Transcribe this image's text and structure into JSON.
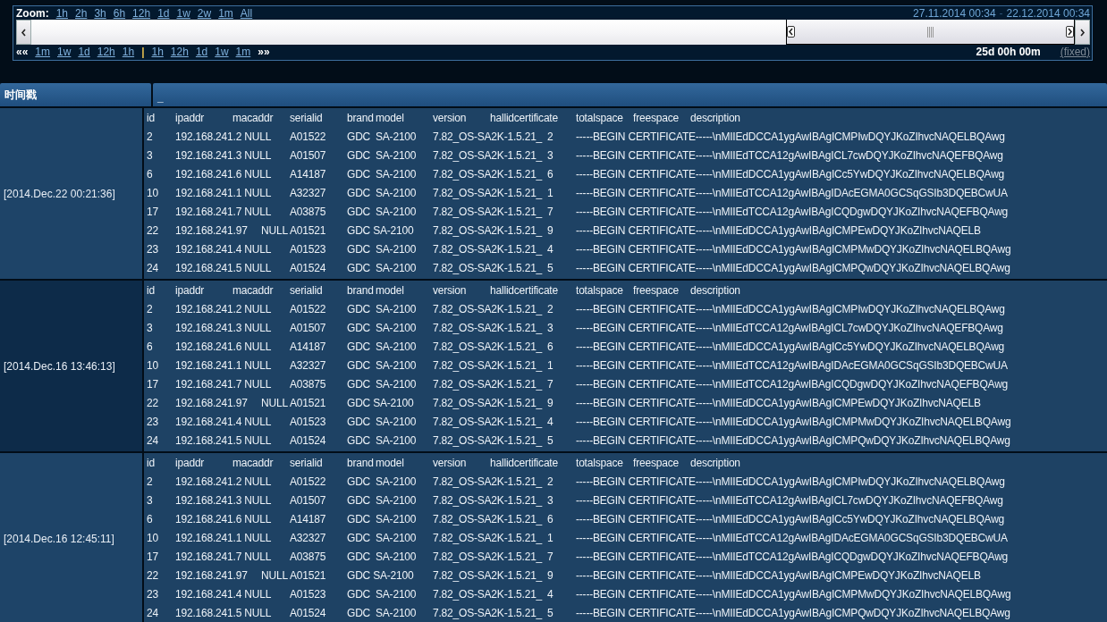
{
  "zoom_bar": {
    "label": "Zoom:",
    "presets": [
      "1h",
      "2h",
      "3h",
      "6h",
      "12h",
      "1d",
      "1w",
      "2w",
      "1m",
      "All"
    ],
    "range_start": "27.11.2014 00:34",
    "range_separator": "-",
    "range_end": "22.12.2014 00:34"
  },
  "pan_bar": {
    "back_arrows": "««",
    "back_steps": [
      "1m",
      "1w",
      "1d",
      "12h",
      "1h"
    ],
    "separator": "|",
    "forward_steps": [
      "1h",
      "12h",
      "1d",
      "1w",
      "1m"
    ],
    "forward_arrows": "»»",
    "duration": "25d 00h 00m",
    "mode": "(fixed)"
  },
  "table": {
    "columns": [
      "时间戳",
      "_"
    ],
    "groups": [
      {
        "timestamp": "[2014.Dec.22 00:21:36]",
        "highlighted": false,
        "lines": [
          "id\tipaddr\tmacaddr\tserialid\tbrand\tmodel\tversion\thallidcertificate\ttotalspace\tfreespace\tdescription",
          "2\t192.168.241.2 NULL\tA01522\tGDC\tSA-2100\t7.82_OS-SA2K-1.5.21_\t2\t-----BEGIN CERTIFICATE-----\\nMIIEdDCCA1ygAwIBAgICMPIwDQYJKoZIhvcNAQELBQAwg",
          "3\t192.168.241.3 NULL\tA01507\tGDC\tSA-2100\t7.82_OS-SA2K-1.5.21_\t3\t-----BEGIN CERTIFICATE-----\\nMIIEdTCCA12gAwIBAgICL7cwDQYJKoZIhvcNAQEFBQAwg",
          "6\t192.168.241.6 NULL\tA14187\tGDC\tSA-2100\t7.82_OS-SA2K-1.5.21_\t6\t-----BEGIN CERTIFICATE-----\\nMIIEdDCCA1ygAwIBAgICc5YwDQYJKoZIhvcNAQELBQAwg",
          "10\t192.168.241.1 NULL\tA32327\tGDC\tSA-2100\t7.82_OS-SA2K-1.5.21_\t1\t-----BEGIN CERTIFICATE-----\\nMIIEdTCCA12gAwIBAgIDAcEGMA0GCSqGSIb3DQEBCwUA",
          "17\t192.168.241.7 NULL\tA03875\tGDC\tSA-2100\t7.82_OS-SA2K-1.5.21_\t7\t-----BEGIN CERTIFICATE-----\\nMIIEdTCCA12gAwIBAgICQDgwDQYJKoZIhvcNAQEFBQAwg",
          "22\t192.168.241.97\tNULL\tA01521\tGDC SA-2100\t7.82_OS-SA2K-1.5.21_\t9\t-----BEGIN CERTIFICATE-----\\nMIIEdDCCA1ygAwIBAgICMPEwDQYJKoZIhvcNAQELB",
          "23\t192.168.241.4 NULL\tA01523\tGDC\tSA-2100\t7.82_OS-SA2K-1.5.21_\t4\t-----BEGIN CERTIFICATE-----\\nMIIEdDCCA1ygAwIBAgICMPMwDQYJKoZIhvcNAQELBQAwg",
          "24\t192.168.241.5 NULL\tA01524\tGDC\tSA-2100\t7.82_OS-SA2K-1.5.21_\t5\t-----BEGIN CERTIFICATE-----\\nMIIEdDCCA1ygAwIBAgICMPQwDQYJKoZIhvcNAQELBQAwg"
        ]
      },
      {
        "timestamp": "[2014.Dec.16 13:46:13]",
        "highlighted": true,
        "lines": [
          "id\tipaddr\tmacaddr\tserialid\tbrand\tmodel\tversion\thallidcertificate\ttotalspace\tfreespace\tdescription",
          "2\t192.168.241.2 NULL\tA01522\tGDC\tSA-2100\t7.82_OS-SA2K-1.5.21_\t2\t-----BEGIN CERTIFICATE-----\\nMIIEdDCCA1ygAwIBAgICMPIwDQYJKoZIhvcNAQELBQAwg",
          "3\t192.168.241.3 NULL\tA01507\tGDC\tSA-2100\t7.82_OS-SA2K-1.5.21_\t3\t-----BEGIN CERTIFICATE-----\\nMIIEdTCCA12gAwIBAgICL7cwDQYJKoZIhvcNAQEFBQAwg",
          "6\t192.168.241.6 NULL\tA14187\tGDC\tSA-2100\t7.82_OS-SA2K-1.5.21_\t6\t-----BEGIN CERTIFICATE-----\\nMIIEdDCCA1ygAwIBAgICc5YwDQYJKoZIhvcNAQELBQAwg",
          "10\t192.168.241.1 NULL\tA32327\tGDC\tSA-2100\t7.82_OS-SA2K-1.5.21_\t1\t-----BEGIN CERTIFICATE-----\\nMIIEdTCCA12gAwIBAgIDAcEGMA0GCSqGSIb3DQEBCwUA",
          "17\t192.168.241.7 NULL\tA03875\tGDC\tSA-2100\t7.82_OS-SA2K-1.5.21_\t7\t-----BEGIN CERTIFICATE-----\\nMIIEdTCCA12gAwIBAgICQDgwDQYJKoZIhvcNAQEFBQAwg",
          "22\t192.168.241.97\tNULL\tA01521\tGDC SA-2100\t7.82_OS-SA2K-1.5.21_\t9\t-----BEGIN CERTIFICATE-----\\nMIIEdDCCA1ygAwIBAgICMPEwDQYJKoZIhvcNAQELB",
          "23\t192.168.241.4 NULL\tA01523\tGDC\tSA-2100\t7.82_OS-SA2K-1.5.21_\t4\t-----BEGIN CERTIFICATE-----\\nMIIEdDCCA1ygAwIBAgICMPMwDQYJKoZIhvcNAQELBQAwg",
          "24\t192.168.241.5 NULL\tA01524\tGDC\tSA-2100\t7.82_OS-SA2K-1.5.21_\t5\t-----BEGIN CERTIFICATE-----\\nMIIEdDCCA1ygAwIBAgICMPQwDQYJKoZIhvcNAQELBQAwg"
        ]
      },
      {
        "timestamp": "[2014.Dec.16 12:45:11]",
        "highlighted": false,
        "lines": [
          "id\tipaddr\tmacaddr\tserialid\tbrand\tmodel\tversion\thallidcertificate\ttotalspace\tfreespace\tdescription",
          "2\t192.168.241.2 NULL\tA01522\tGDC\tSA-2100\t7.82_OS-SA2K-1.5.21_\t2\t-----BEGIN CERTIFICATE-----\\nMIIEdDCCA1ygAwIBAgICMPIwDQYJKoZIhvcNAQELBQAwg",
          "3\t192.168.241.3 NULL\tA01507\tGDC\tSA-2100\t7.82_OS-SA2K-1.5.21_\t3\t-----BEGIN CERTIFICATE-----\\nMIIEdTCCA12gAwIBAgICL7cwDQYJKoZIhvcNAQEFBQAwg",
          "6\t192.168.241.6 NULL\tA14187\tGDC\tSA-2100\t7.82_OS-SA2K-1.5.21_\t6\t-----BEGIN CERTIFICATE-----\\nMIIEdDCCA1ygAwIBAgICc5YwDQYJKoZIhvcNAQELBQAwg",
          "10\t192.168.241.1 NULL\tA32327\tGDC\tSA-2100\t7.82_OS-SA2K-1.5.21_\t1\t-----BEGIN CERTIFICATE-----\\nMIIEdTCCA12gAwIBAgIDAcEGMA0GCSqGSIb3DQEBCwUA",
          "17\t192.168.241.7 NULL\tA03875\tGDC\tSA-2100\t7.82_OS-SA2K-1.5.21_\t7\t-----BEGIN CERTIFICATE-----\\nMIIEdTCCA12gAwIBAgICQDgwDQYJKoZIhvcNAQEFBQAwg",
          "22\t192.168.241.97\tNULL\tA01521\tGDC SA-2100\t7.82_OS-SA2K-1.5.21_\t9\t-----BEGIN CERTIFICATE-----\\nMIIEdDCCA1ygAwIBAgICMPEwDQYJKoZIhvcNAQELB",
          "23\t192.168.241.4 NULL\tA01523\tGDC\tSA-2100\t7.82_OS-SA2K-1.5.21_\t4\t-----BEGIN CERTIFICATE-----\\nMIIEdDCCA1ygAwIBAgICMPMwDQYJKoZIhvcNAQELBQAwg",
          "24\t192.168.241.5 NULL\tA01524\tGDC\tSA-2100\t7.82_OS-SA2K-1.5.21_\t5\t-----BEGIN CERTIFICATE-----\\nMIIEdDCCA1ygAwIBAgICMPQwDQYJKoZIhvcNAQELBQAwg"
        ]
      }
    ]
  }
}
